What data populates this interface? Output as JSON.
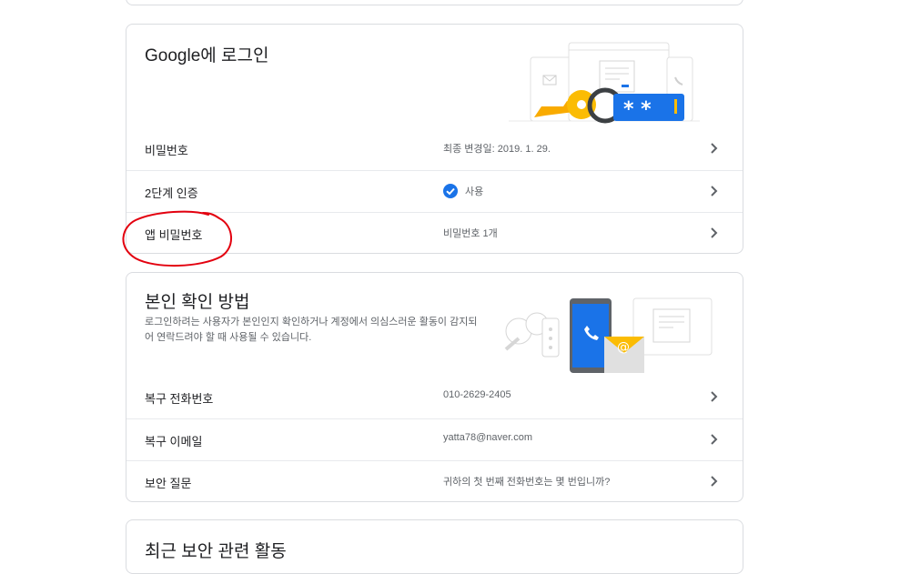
{
  "signin": {
    "title": "Google에 로그인",
    "rows": [
      {
        "label": "비밀번호",
        "value": "최종 변경일: 2019. 1. 29."
      },
      {
        "label": "2단계 인증",
        "value": "사용"
      },
      {
        "label": "앱 비밀번호",
        "value": "비밀번호 1개"
      }
    ]
  },
  "verify": {
    "title": "본인 확인 방법",
    "description": "로그인하려는 사용자가 본인인지 확인하거나 계정에서 의심스러운 활동이 감지되어 연락드려야 할 때 사용될 수 있습니다.",
    "rows": [
      {
        "label": "복구 전화번호",
        "value": "010-2629-2405"
      },
      {
        "label": "복구 이메일",
        "value": "yatta78@naver.com"
      },
      {
        "label": "보안 질문",
        "value": "귀하의 첫 번째 전화번호는 몇 번입니까?"
      }
    ]
  },
  "recent": {
    "title": "최근 보안 관련 활동"
  },
  "colors": {
    "accent_blue": "#1a73e8",
    "key_yellow": "#fbbc04",
    "annotation_red": "#e3000f"
  },
  "icons": [
    "chevron-right-icon",
    "check-circle-icon"
  ]
}
